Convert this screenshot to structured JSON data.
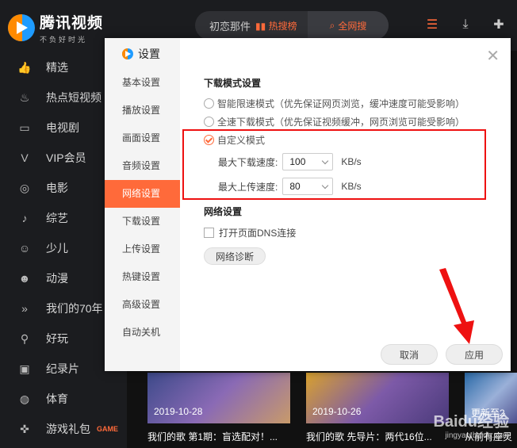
{
  "app": {
    "name": "腾讯视频",
    "slogan": "不负好时光"
  },
  "sidebar": {
    "items": [
      {
        "label": "精选",
        "icon": "thumbs-up-icon"
      },
      {
        "label": "热点短视频",
        "icon": "flame-icon"
      },
      {
        "label": "电视剧",
        "icon": "tv-icon"
      },
      {
        "label": "VIP会员",
        "icon": "vip-icon"
      },
      {
        "label": "电影",
        "icon": "film-reel-icon"
      },
      {
        "label": "综艺",
        "icon": "microphone-icon"
      },
      {
        "label": "少儿",
        "icon": "child-icon"
      },
      {
        "label": "动漫",
        "icon": "cartoon-face-icon"
      },
      {
        "label": "我们的70年",
        "icon": "chevron-double-icon"
      },
      {
        "label": "好玩",
        "icon": "joystick-icon"
      },
      {
        "label": "纪录片",
        "icon": "camera-icon"
      },
      {
        "label": "体育",
        "icon": "basketball-icon"
      },
      {
        "label": "游戏礼包",
        "icon": "gamepad-icon",
        "badge": "GAME"
      }
    ]
  },
  "topbar": {
    "hot_search_text": "初恋那件",
    "hot_rank_label": "热搜榜",
    "all_net_label": "全网搜"
  },
  "content": {
    "videos": [
      {
        "date": "2019-10-28",
        "title": "我们的歌 第1期：盲选配对！..."
      },
      {
        "date": "2019-10-26",
        "title": "我们的歌 先导片：两代16位..."
      },
      {
        "date": "更新至2",
        "title": "从前有座灵"
      }
    ]
  },
  "dialog": {
    "title": "设置",
    "menu": [
      {
        "label": "基本设置",
        "active": false
      },
      {
        "label": "播放设置",
        "active": false
      },
      {
        "label": "画面设置",
        "active": false
      },
      {
        "label": "音频设置",
        "active": false
      },
      {
        "label": "网络设置",
        "active": true
      },
      {
        "label": "下载设置",
        "active": false
      },
      {
        "label": "上传设置",
        "active": false
      },
      {
        "label": "热键设置",
        "active": false
      },
      {
        "label": "高级设置",
        "active": false
      },
      {
        "label": "自动关机",
        "active": false
      }
    ],
    "download_mode": {
      "section_title": "下载模式设置",
      "options": [
        {
          "label": "智能限速模式（优先保证网页浏览，缓冲速度可能受影响）",
          "selected": false
        },
        {
          "label": "全速下载模式（优先保证视频缓冲，网页浏览可能受影响）",
          "selected": false
        },
        {
          "label": "自定义模式",
          "selected": true
        }
      ],
      "max_download_label": "最大下载速度:",
      "max_download_value": "100",
      "max_upload_label": "最大上传速度:",
      "max_upload_value": "80",
      "unit": "KB/s"
    },
    "network": {
      "section_title": "网络设置",
      "dns_label": "打开页面DNS连接",
      "diagnose_label": "网络诊断"
    },
    "cancel_label": "取消",
    "apply_label": "应用"
  },
  "watermark": {
    "brand": "Baidu经验",
    "url": "jingyan.baidu.com"
  },
  "colors": {
    "accent": "#ff6a3a",
    "highlight": "#e11111"
  }
}
